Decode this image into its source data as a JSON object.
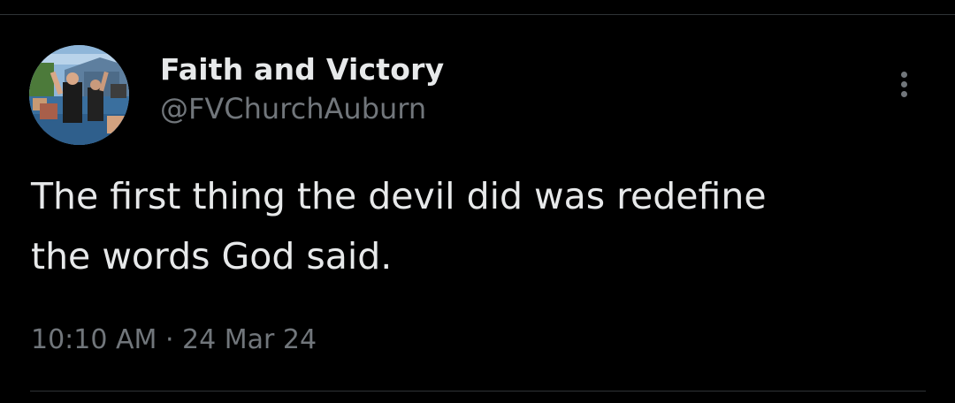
{
  "tweet": {
    "author": {
      "display_name": "Faith and Victory",
      "handle": "@FVChurchAuburn",
      "avatar_icon": "profile-photo"
    },
    "text_lines": [
      "The first thing the devil did was redefine",
      "the words God said."
    ],
    "time": "10:10 AM",
    "separator": "·",
    "date": "24 Mar 24",
    "more_icon": "more-vertical-icon"
  },
  "colors": {
    "background": "#000000",
    "primary_text": "#e7e9ea",
    "secondary_text": "#71767b",
    "divider": "#2f3336"
  }
}
